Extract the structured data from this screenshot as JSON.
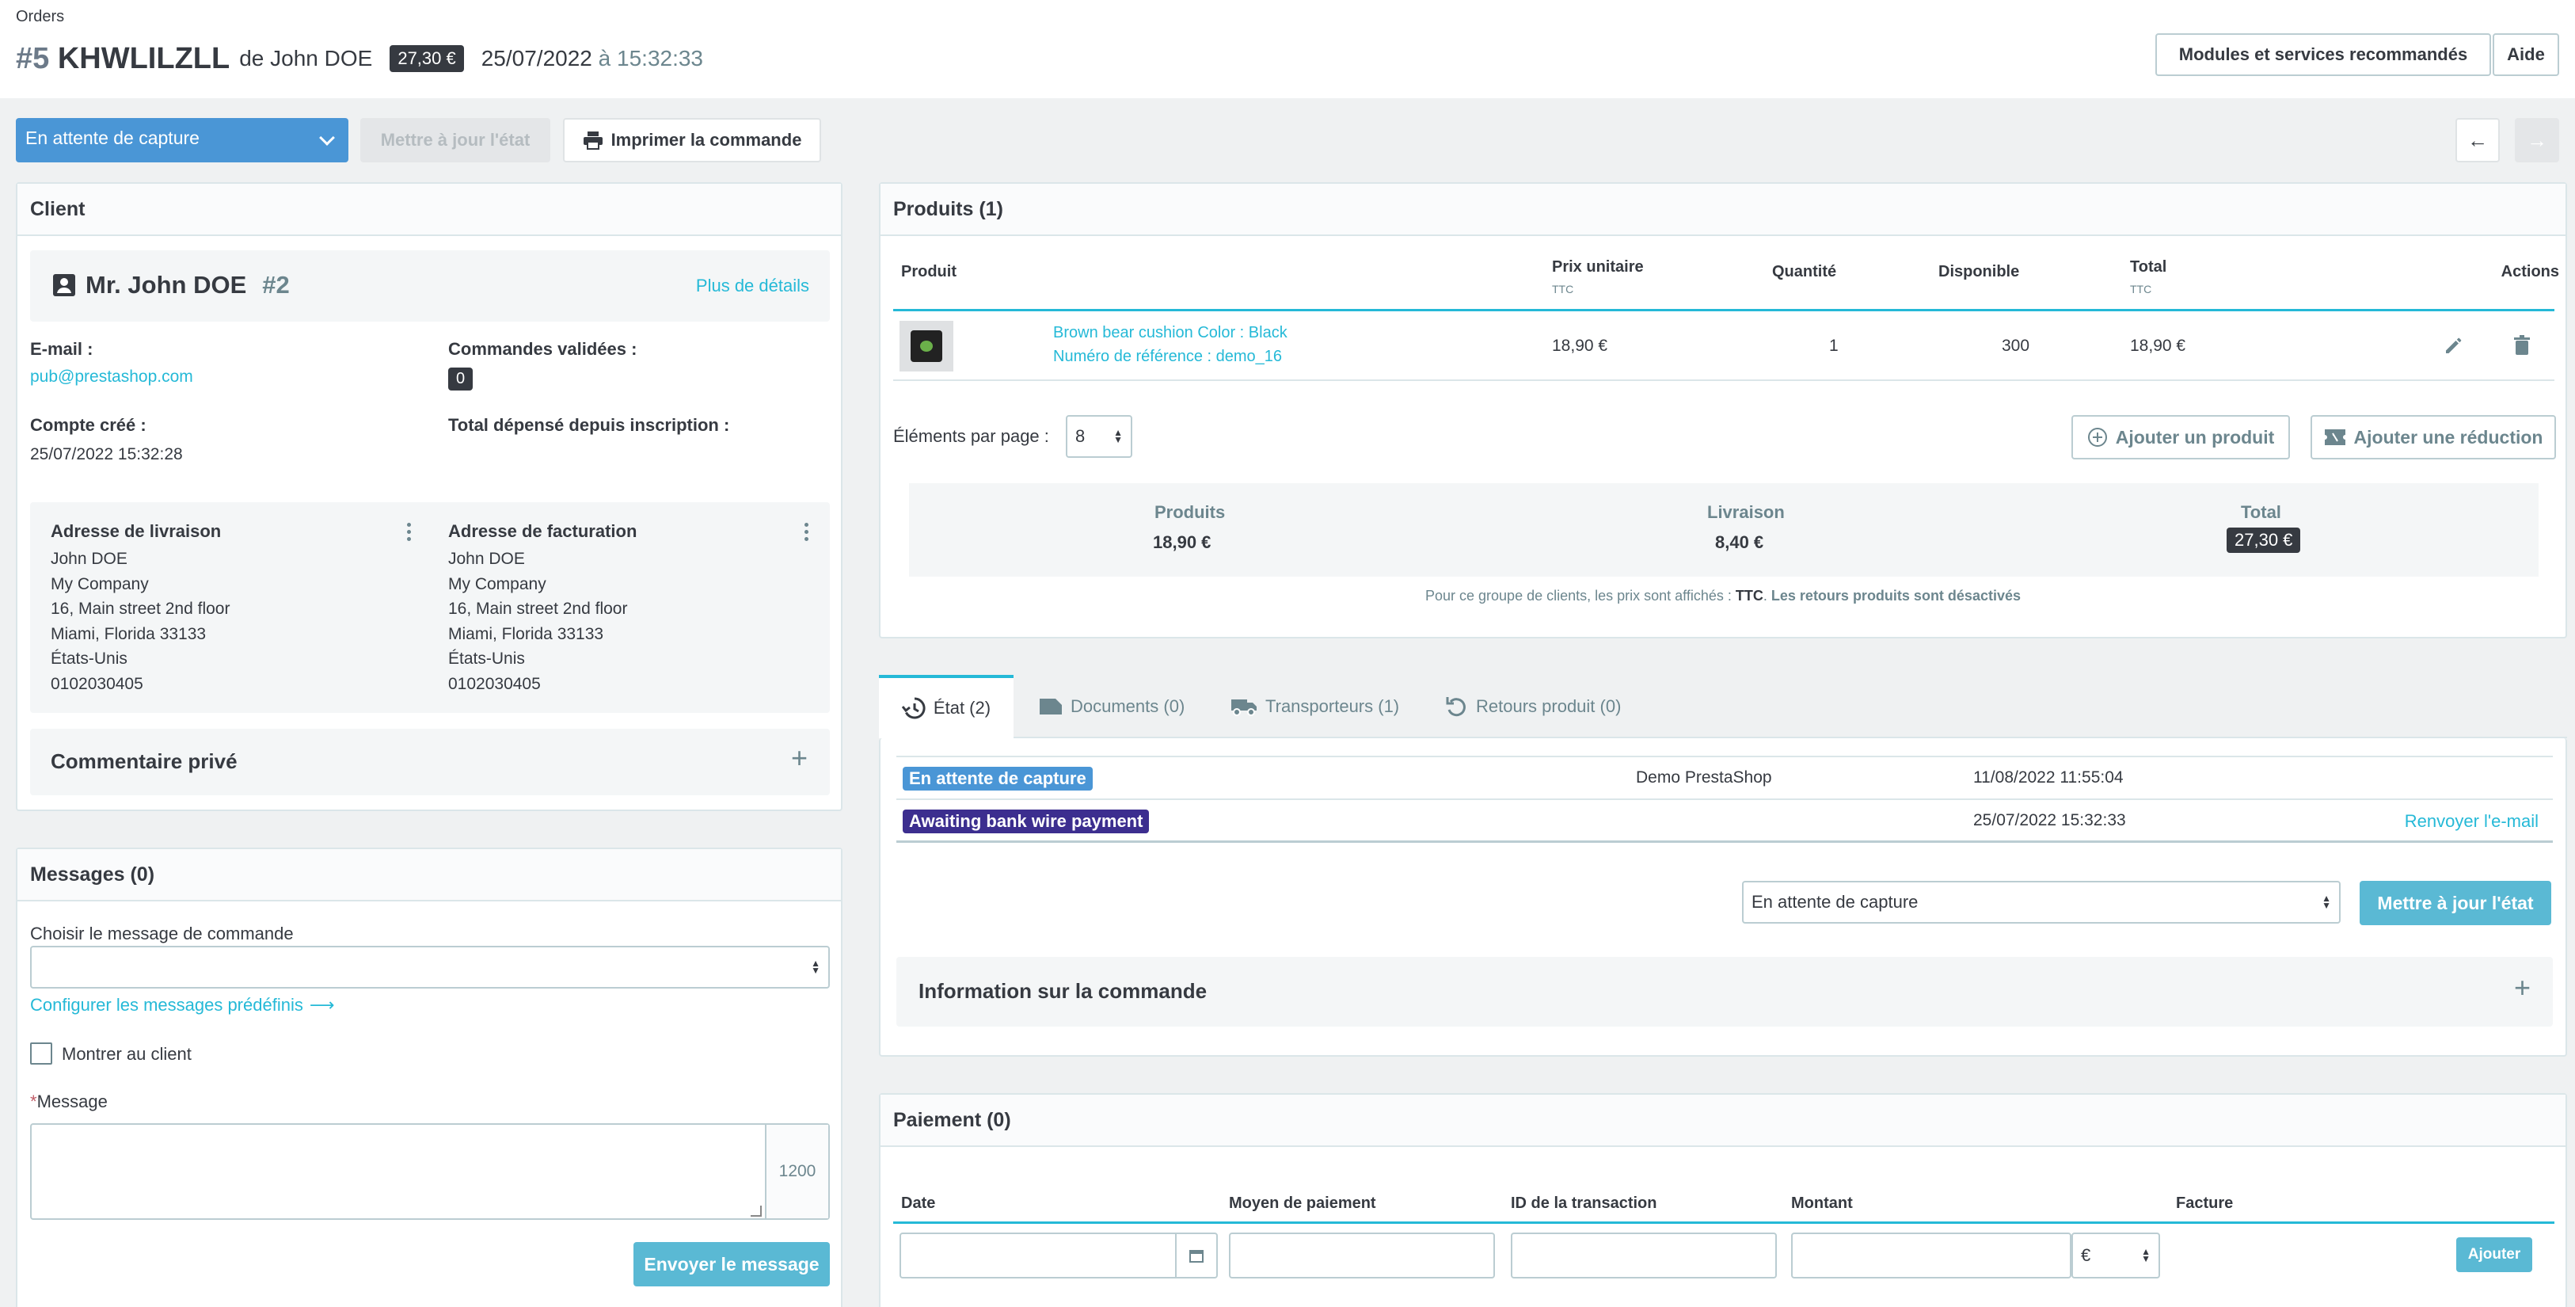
{
  "breadcrumb": [
    "Orders"
  ],
  "header": {
    "order_number": "#5",
    "order_reference": "KHWLILZLL",
    "customer_text": "de John DOE",
    "total_badge": "27,30 €",
    "date": "25/07/2022",
    "date_connector": "à",
    "time": "15:32:33",
    "modules_button": "Modules et services recommandés",
    "help_button": "Aide"
  },
  "toolbar": {
    "status_select": "En attente de capture",
    "update_status_button": "Mettre à jour l'état",
    "print_button": "Imprimer la commande",
    "prev_icon": "arrow-left-icon",
    "next_icon": "arrow-right-icon"
  },
  "client": {
    "title": "Client",
    "name": "Mr. John DOE",
    "id": "#2",
    "details_link": "Plus de détails",
    "email_label": "E-mail :",
    "email": "pub@prestashop.com",
    "validated_orders_label": "Commandes validées :",
    "validated_orders_count": "0",
    "account_created_label": "Compte créé :",
    "account_created": "25/07/2022 15:32:28",
    "total_spent_label": "Total dépensé depuis inscription :",
    "shipping_address": {
      "title": "Adresse de livraison",
      "lines": [
        "John DOE",
        "My Company",
        "16, Main street 2nd floor",
        "Miami, Florida 33133",
        "États-Unis",
        "0102030405"
      ]
    },
    "billing_address": {
      "title": "Adresse de facturation",
      "lines": [
        "John DOE",
        "My Company",
        "16, Main street 2nd floor",
        "Miami, Florida 33133",
        "États-Unis",
        "0102030405"
      ]
    },
    "private_comment": "Commentaire privé"
  },
  "messages": {
    "title": "Messages (0)",
    "choose_label": "Choisir le message de commande",
    "configure_link": "Configurer les messages prédéfinis",
    "show_client_label": "Montrer au client",
    "message_label": "Message",
    "required_mark": "*",
    "char_counter": "1200",
    "send_button": "Envoyer le message"
  },
  "products": {
    "title": "Produits (1)",
    "columns": {
      "product": "Produit",
      "unit_price": "Prix unitaire",
      "unit_price_sub": "TTC",
      "quantity": "Quantité",
      "available": "Disponible",
      "total": "Total",
      "total_sub": "TTC",
      "actions": "Actions"
    },
    "rows": [
      {
        "name": "Brown bear cushion Color : Black",
        "reference": "Numéro de référence : demo_16",
        "unit_price": "18,90 €",
        "quantity": "1",
        "available": "300",
        "total": "18,90 €"
      }
    ],
    "per_page_label": "Éléments par page :",
    "per_page_value": "8",
    "add_product_button": "Ajouter un produit",
    "add_discount_button": "Ajouter une réduction",
    "summary": {
      "products_label": "Produits",
      "products_value": "18,90 €",
      "shipping_label": "Livraison",
      "shipping_value": "8,40 €",
      "total_label": "Total",
      "total_value": "27,30 €"
    },
    "note_prefix": "Pour ce groupe de clients, les prix sont affichés : ",
    "note_ttc": "TTC",
    "note_sep": ". ",
    "note_returns": "Les retours produits sont désactivés"
  },
  "tabs": [
    {
      "label": "État (2)",
      "icon": "history-icon"
    },
    {
      "label": "Documents (0)",
      "icon": "document-icon"
    },
    {
      "label": "Transporteurs (1)",
      "icon": "truck-icon"
    },
    {
      "label": "Retours produit (0)",
      "icon": "undo-icon"
    }
  ],
  "history": {
    "rows": [
      {
        "status": "En attente de capture",
        "color": "#4a96d6",
        "employee": "Demo PrestaShop",
        "date": "11/08/2022 11:55:04",
        "action": ""
      },
      {
        "status": "Awaiting bank wire payment",
        "color": "#3c2e8f",
        "employee": "",
        "date": "25/07/2022 15:32:33",
        "action": "Renvoyer l'e-mail"
      }
    ],
    "status_select": "En attente de capture",
    "update_button": "Mettre à jour l'état",
    "order_info": "Information sur la commande"
  },
  "payment": {
    "title": "Paiement (0)",
    "columns": {
      "date": "Date",
      "method": "Moyen de paiement",
      "transaction": "ID de la transaction",
      "amount": "Montant",
      "invoice": "Facture"
    },
    "currency": "€",
    "add_button": "Ajouter"
  },
  "colors": {
    "accent": "#25b9d7",
    "primary_blue": "#4a96d6",
    "dark_badge": "#363a41"
  }
}
